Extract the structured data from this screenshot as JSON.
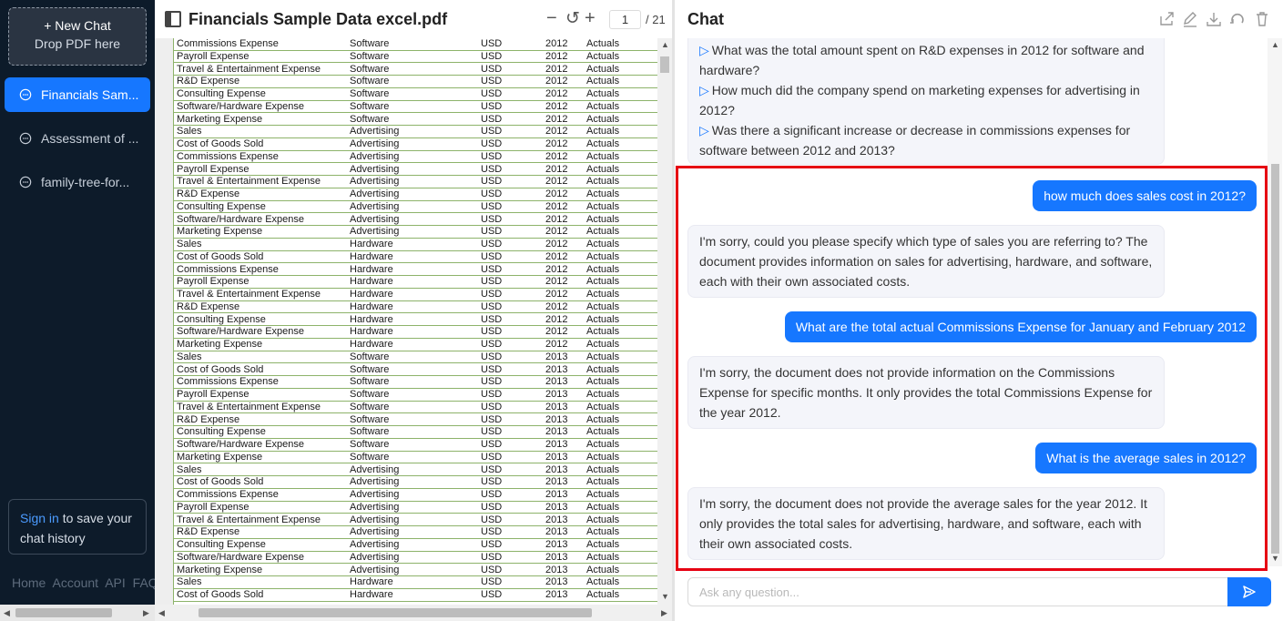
{
  "sidebar": {
    "new_chat_label": "+ New Chat",
    "drop_label": "Drop PDF here",
    "items": [
      {
        "label": "Financials Sam...",
        "active": true
      },
      {
        "label": "Assessment of ..."
      },
      {
        "label": "family-tree-for..."
      }
    ],
    "signin_link": "Sign in",
    "signin_text": " to save your chat history",
    "footer": [
      "Home",
      "Account",
      "API",
      "FAQ"
    ]
  },
  "pdf": {
    "title": "Financials Sample Data excel.pdf",
    "page_current": "1",
    "page_total": "/ 21",
    "rows": [
      [
        "Commissions Expense",
        "Software",
        "USD",
        "2012",
        "Actuals"
      ],
      [
        "Payroll Expense",
        "Software",
        "USD",
        "2012",
        "Actuals"
      ],
      [
        "Travel & Entertainment Expense",
        "Software",
        "USD",
        "2012",
        "Actuals"
      ],
      [
        "R&D Expense",
        "Software",
        "USD",
        "2012",
        "Actuals"
      ],
      [
        "Consulting Expense",
        "Software",
        "USD",
        "2012",
        "Actuals"
      ],
      [
        "Software/Hardware Expense",
        "Software",
        "USD",
        "2012",
        "Actuals"
      ],
      [
        "Marketing Expense",
        "Software",
        "USD",
        "2012",
        "Actuals"
      ],
      [
        "Sales",
        "Advertising",
        "USD",
        "2012",
        "Actuals"
      ],
      [
        "Cost of Goods Sold",
        "Advertising",
        "USD",
        "2012",
        "Actuals"
      ],
      [
        "Commissions Expense",
        "Advertising",
        "USD",
        "2012",
        "Actuals"
      ],
      [
        "Payroll Expense",
        "Advertising",
        "USD",
        "2012",
        "Actuals"
      ],
      [
        "Travel & Entertainment Expense",
        "Advertising",
        "USD",
        "2012",
        "Actuals"
      ],
      [
        "R&D Expense",
        "Advertising",
        "USD",
        "2012",
        "Actuals"
      ],
      [
        "Consulting Expense",
        "Advertising",
        "USD",
        "2012",
        "Actuals"
      ],
      [
        "Software/Hardware Expense",
        "Advertising",
        "USD",
        "2012",
        "Actuals"
      ],
      [
        "Marketing Expense",
        "Advertising",
        "USD",
        "2012",
        "Actuals"
      ],
      [
        "Sales",
        "Hardware",
        "USD",
        "2012",
        "Actuals"
      ],
      [
        "Cost of Goods Sold",
        "Hardware",
        "USD",
        "2012",
        "Actuals"
      ],
      [
        "Commissions Expense",
        "Hardware",
        "USD",
        "2012",
        "Actuals"
      ],
      [
        "Payroll Expense",
        "Hardware",
        "USD",
        "2012",
        "Actuals"
      ],
      [
        "Travel & Entertainment Expense",
        "Hardware",
        "USD",
        "2012",
        "Actuals"
      ],
      [
        "R&D Expense",
        "Hardware",
        "USD",
        "2012",
        "Actuals"
      ],
      [
        "Consulting Expense",
        "Hardware",
        "USD",
        "2012",
        "Actuals"
      ],
      [
        "Software/Hardware Expense",
        "Hardware",
        "USD",
        "2012",
        "Actuals"
      ],
      [
        "Marketing Expense",
        "Hardware",
        "USD",
        "2012",
        "Actuals"
      ],
      [
        "Sales",
        "Software",
        "USD",
        "2013",
        "Actuals"
      ],
      [
        "Cost of Goods Sold",
        "Software",
        "USD",
        "2013",
        "Actuals"
      ],
      [
        "Commissions Expense",
        "Software",
        "USD",
        "2013",
        "Actuals"
      ],
      [
        "Payroll Expense",
        "Software",
        "USD",
        "2013",
        "Actuals"
      ],
      [
        "Travel & Entertainment Expense",
        "Software",
        "USD",
        "2013",
        "Actuals"
      ],
      [
        "R&D Expense",
        "Software",
        "USD",
        "2013",
        "Actuals"
      ],
      [
        "Consulting Expense",
        "Software",
        "USD",
        "2013",
        "Actuals"
      ],
      [
        "Software/Hardware Expense",
        "Software",
        "USD",
        "2013",
        "Actuals"
      ],
      [
        "Marketing Expense",
        "Software",
        "USD",
        "2013",
        "Actuals"
      ],
      [
        "Sales",
        "Advertising",
        "USD",
        "2013",
        "Actuals"
      ],
      [
        "Cost of Goods Sold",
        "Advertising",
        "USD",
        "2013",
        "Actuals"
      ],
      [
        "Commissions Expense",
        "Advertising",
        "USD",
        "2013",
        "Actuals"
      ],
      [
        "Payroll Expense",
        "Advertising",
        "USD",
        "2013",
        "Actuals"
      ],
      [
        "Travel & Entertainment Expense",
        "Advertising",
        "USD",
        "2013",
        "Actuals"
      ],
      [
        "R&D Expense",
        "Advertising",
        "USD",
        "2013",
        "Actuals"
      ],
      [
        "Consulting Expense",
        "Advertising",
        "USD",
        "2013",
        "Actuals"
      ],
      [
        "Software/Hardware Expense",
        "Advertising",
        "USD",
        "2013",
        "Actuals"
      ],
      [
        "Marketing Expense",
        "Advertising",
        "USD",
        "2013",
        "Actuals"
      ],
      [
        "Sales",
        "Hardware",
        "USD",
        "2013",
        "Actuals"
      ],
      [
        "Cost of Goods Sold",
        "Hardware",
        "USD",
        "2013",
        "Actuals"
      ]
    ]
  },
  "chat": {
    "title": "Chat",
    "suggestions": [
      "What was the total amount spent on R&D expenses in 2012 for software and hardware?",
      "How much did the company spend on marketing expenses for advertising in 2012?",
      "Was there a significant increase or decrease in commissions expenses for software between 2012 and 2013?"
    ],
    "messages": [
      {
        "role": "user",
        "text": "how much does sales cost in 2012?"
      },
      {
        "role": "bot",
        "text": "I'm sorry, could you please specify which type of sales you are referring to? The document provides information on sales for advertising, hardware, and software, each with their own associated costs."
      },
      {
        "role": "user",
        "text": "What are the total actual Commissions Expense for January and February 2012"
      },
      {
        "role": "bot",
        "text": "I'm sorry, the document does not provide information on the Commissions Expense for specific months. It only provides the total Commissions Expense for the year 2012."
      },
      {
        "role": "user",
        "text": "What is the average sales in 2012?"
      },
      {
        "role": "bot",
        "text": "I'm sorry, the document does not provide the average sales for the year 2012. It only provides the total sales for advertising, hardware, and software, each with their own associated costs."
      }
    ],
    "input_placeholder": "Ask any question...",
    "highlight_color": "#e60012",
    "accent_color": "#1677ff"
  }
}
